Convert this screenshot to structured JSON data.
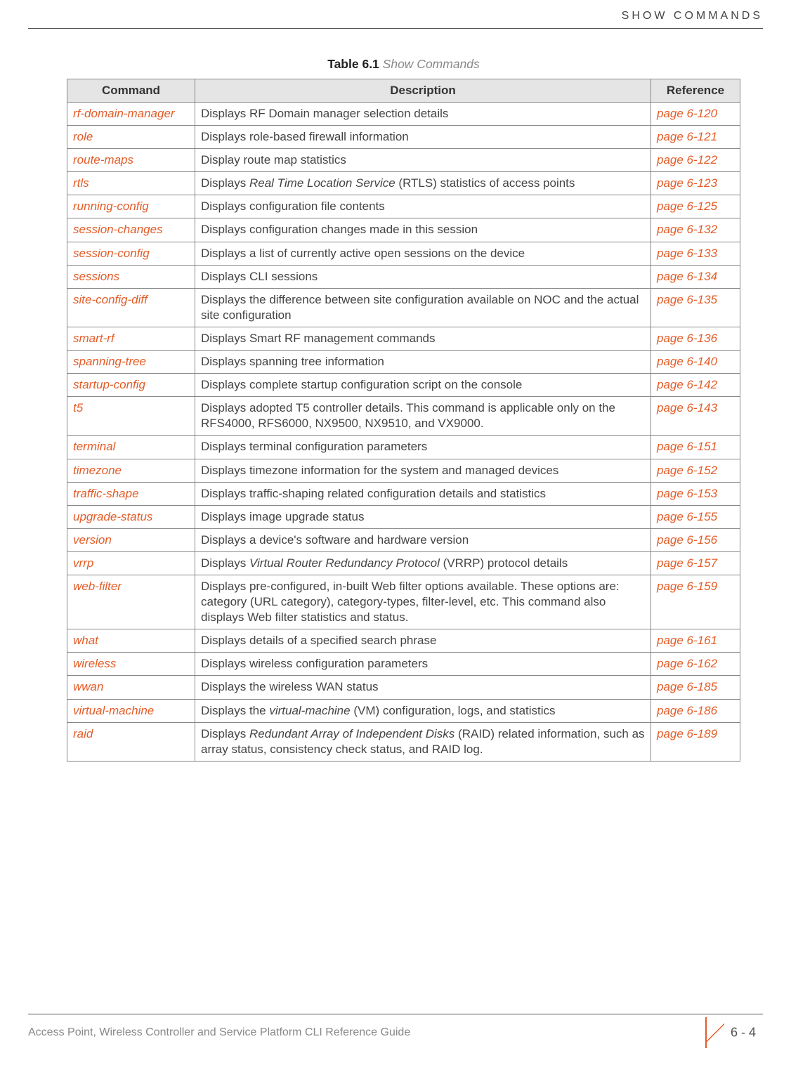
{
  "header": {
    "section_title": "SHOW COMMANDS"
  },
  "table": {
    "caption_label": "Table 6.1",
    "caption_title": "Show Commands",
    "headers": {
      "command": "Command",
      "description": "Description",
      "reference": "Reference"
    },
    "rows": [
      {
        "cmd": "rf-domain-manager",
        "desc": "Displays RF Domain manager selection details",
        "ref": "page 6-120"
      },
      {
        "cmd": "role",
        "desc": "Displays role-based firewall information",
        "ref": "page 6-121"
      },
      {
        "cmd": "route-maps",
        "desc": "Display route map statistics",
        "ref": "page 6-122"
      },
      {
        "cmd": "rtls",
        "desc": "Displays <i>Real Time Location Service</i> (RTLS) statistics of access points",
        "ref": "page 6-123"
      },
      {
        "cmd": "running-config",
        "desc": "Displays configuration file contents",
        "ref": "page 6-125"
      },
      {
        "cmd": "session-changes",
        "desc": "Displays configuration changes made in this session",
        "ref": "page 6-132"
      },
      {
        "cmd": "session-config",
        "desc": "Displays a list of currently active open sessions on the device",
        "ref": "page 6-133"
      },
      {
        "cmd": "sessions",
        "desc": "Displays CLI sessions",
        "ref": "page 6-134"
      },
      {
        "cmd": "site-config-diff",
        "desc": "Displays the difference between site configuration available on NOC and the actual site configuration",
        "ref": "page 6-135"
      },
      {
        "cmd": "smart-rf",
        "desc": "Displays Smart RF management commands",
        "ref": "page 6-136"
      },
      {
        "cmd": "spanning-tree",
        "desc": "Displays spanning tree information",
        "ref": "page 6-140"
      },
      {
        "cmd": "startup-config",
        "desc": "Displays complete startup configuration script on the console",
        "ref": "page 6-142"
      },
      {
        "cmd": "t5",
        "desc": "Displays adopted T5 controller details. This command is applicable only on the RFS4000, RFS6000, NX9500, NX9510, and VX9000.",
        "ref": "page 6-143"
      },
      {
        "cmd": "terminal",
        "desc": "Displays terminal configuration parameters",
        "ref": "page 6-151"
      },
      {
        "cmd": "timezone",
        "desc": "Displays timezone information for the system and managed devices",
        "ref": "page 6-152"
      },
      {
        "cmd": "traffic-shape",
        "desc": "Displays traffic-shaping related configuration details and statistics",
        "ref": "page 6-153"
      },
      {
        "cmd": "upgrade-status",
        "desc": "Displays image upgrade status",
        "ref": "page 6-155"
      },
      {
        "cmd": "version",
        "desc": "Displays a device's software and hardware version",
        "ref": "page 6-156"
      },
      {
        "cmd": "vrrp",
        "desc": "Displays <i>Virtual Router Redundancy Protocol</i> (VRRP) protocol details",
        "ref": "page 6-157"
      },
      {
        "cmd": "web-filter",
        "desc": "Displays pre-configured, in-built Web filter options available. These options are: category (URL category), category-types, filter-level, etc. This command also displays Web filter statistics and status.",
        "ref": "page 6-159"
      },
      {
        "cmd": "what",
        "desc": "Displays details of a specified search phrase",
        "ref": "page 6-161"
      },
      {
        "cmd": "wireless",
        "desc": "Displays wireless configuration parameters",
        "ref": "page 6-162"
      },
      {
        "cmd": "wwan",
        "desc": "Displays the wireless WAN status",
        "ref": "page 6-185"
      },
      {
        "cmd": "virtual-machine",
        "desc": "Displays the <i>virtual-machine</i> (VM) configuration, logs, and statistics",
        "ref": "page 6-186"
      },
      {
        "cmd": "raid",
        "desc": "Displays <i>Redundant Array of Independent Disks</i> (RAID) related information, such as array status, consistency check status, and RAID log.",
        "ref": "page 6-189"
      }
    ]
  },
  "footer": {
    "book_title": "Access Point, Wireless Controller and Service Platform CLI Reference Guide",
    "page_number": "6 - 4"
  }
}
